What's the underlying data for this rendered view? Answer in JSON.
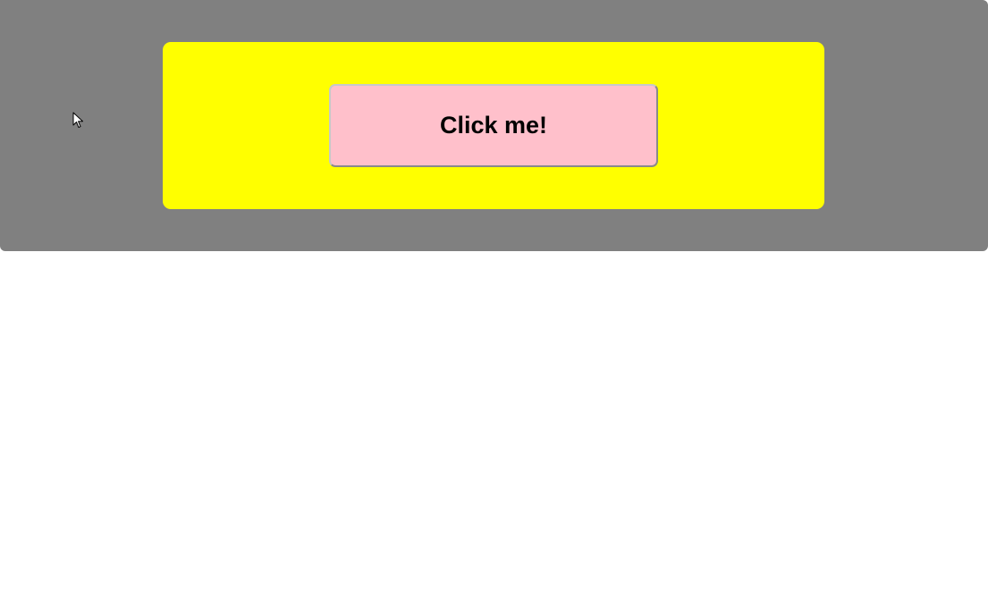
{
  "main": {
    "button_label": "Click me!"
  },
  "colors": {
    "outer_background": "#808080",
    "inner_background": "#ffff00",
    "button_background": "#ffc0cb",
    "page_background": "#ffffff"
  },
  "icons": {
    "cursor": "mouse-pointer-icon"
  }
}
